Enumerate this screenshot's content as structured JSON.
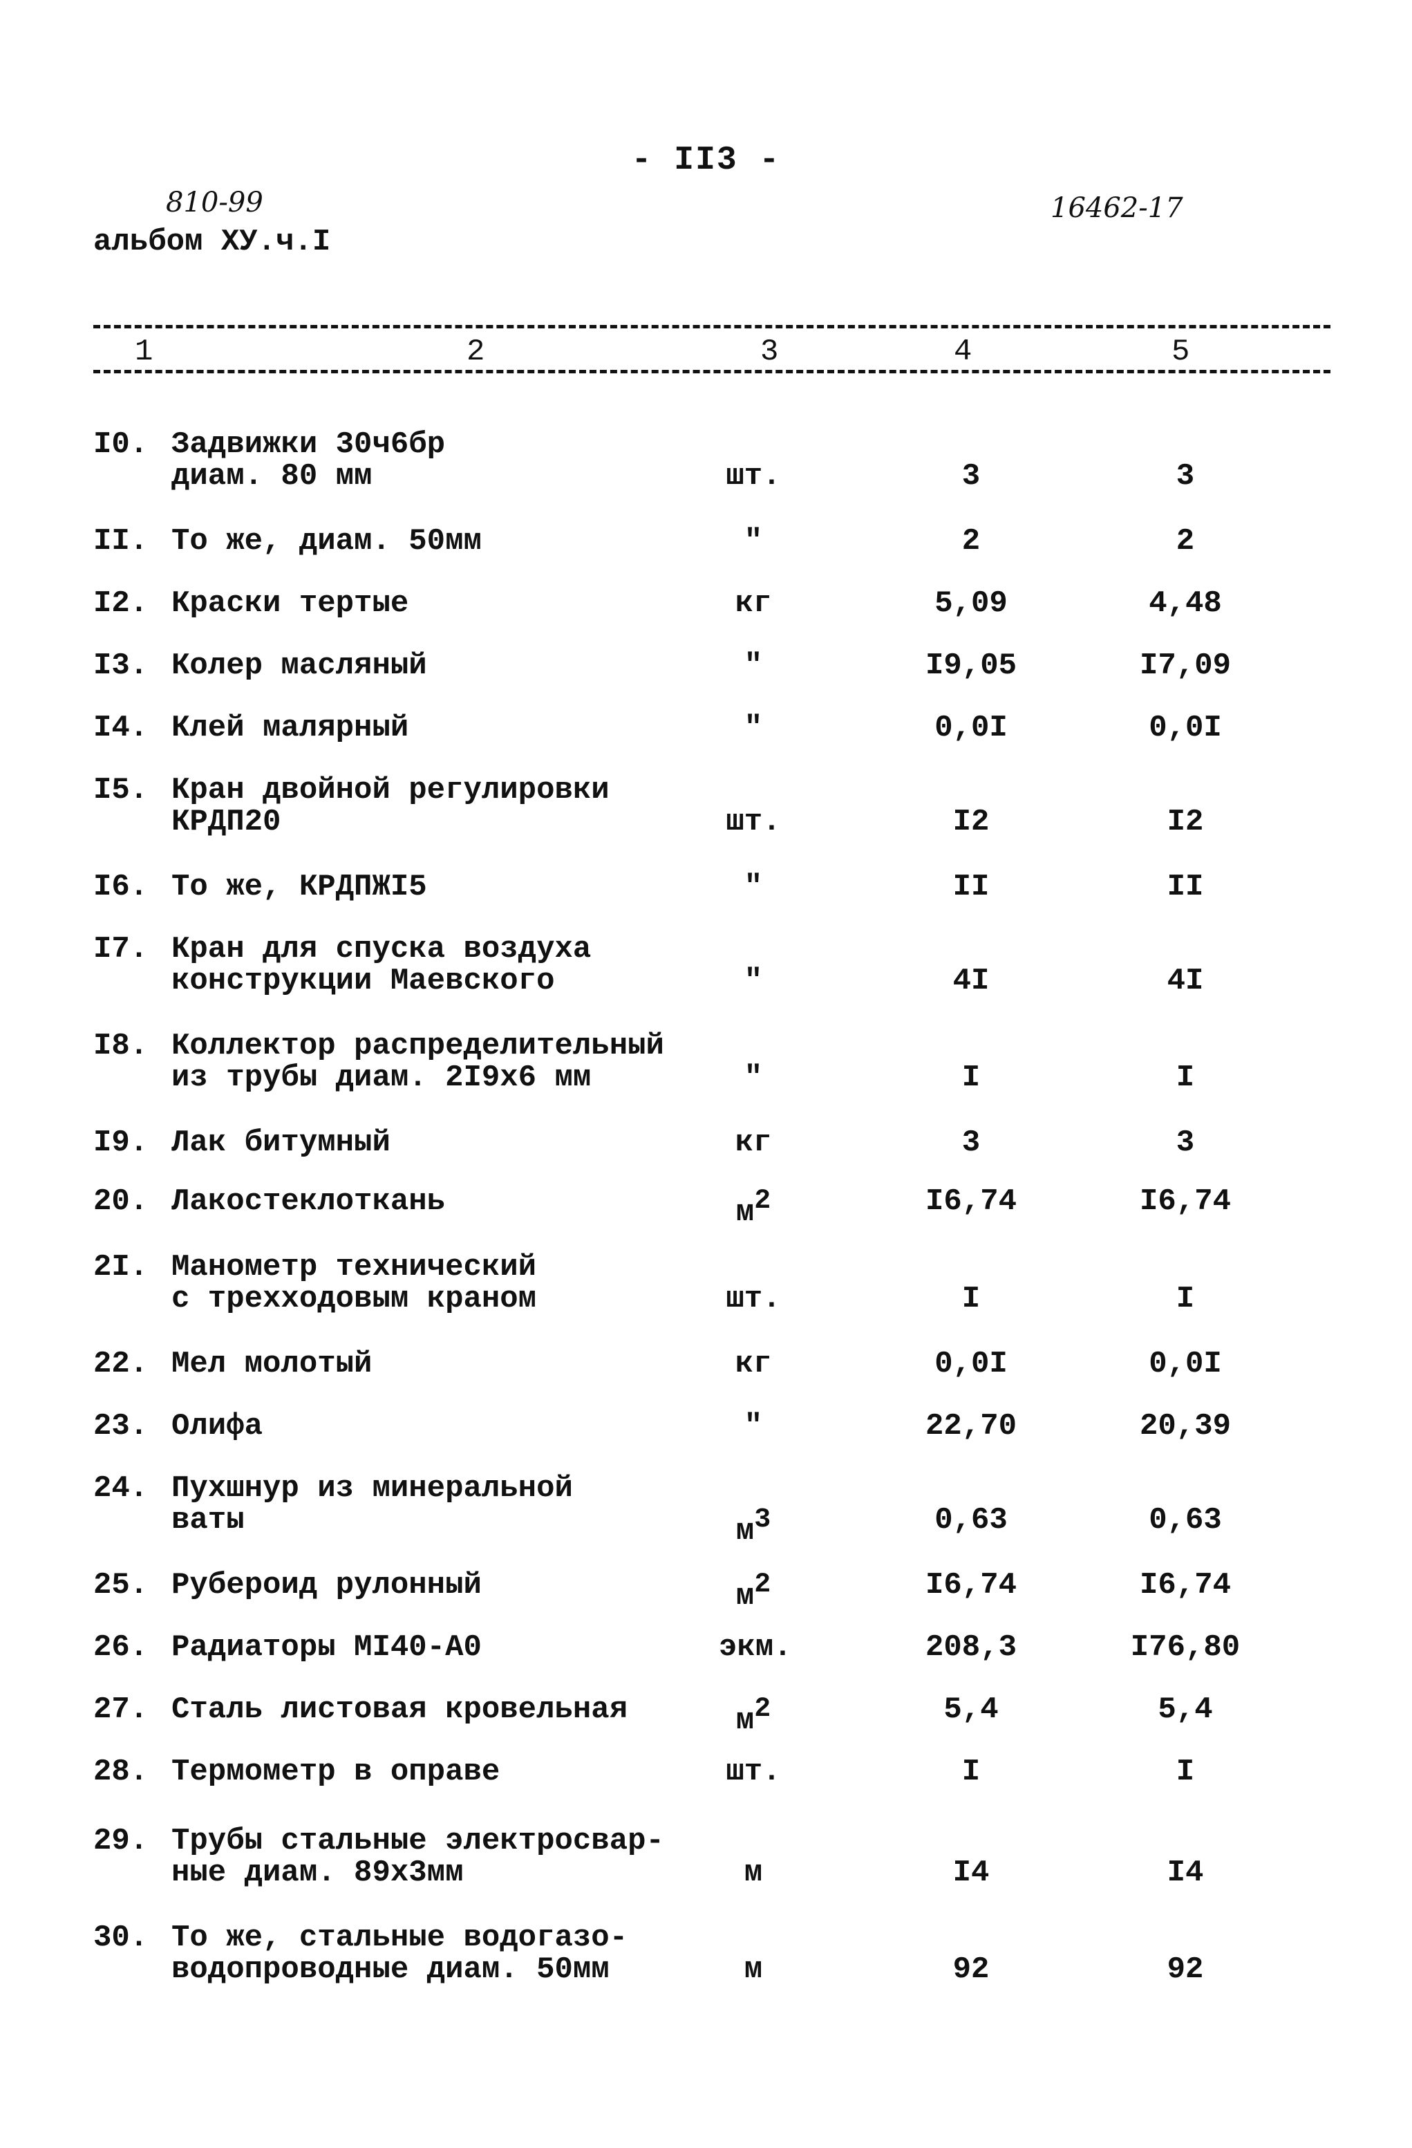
{
  "header": {
    "page_number": "- II3 -",
    "handwritten_left": "810-99",
    "handwritten_right": "16462-17",
    "album": "альбом ХУ.ч.I"
  },
  "columns": [
    "1",
    "2",
    "3",
    "4",
    "5"
  ],
  "rows": [
    {
      "num": "I0.",
      "name": "Задвижки 30ч6бр\nдиам. 80 мм",
      "unit": "шт.",
      "sup": "",
      "c4": "3",
      "c5": "3"
    },
    {
      "num": "II.",
      "name": "То же, диам. 50мм",
      "unit": "\"",
      "sup": "",
      "c4": "2",
      "c5": "2"
    },
    {
      "num": "I2.",
      "name": "Краски тертые",
      "unit": "кг",
      "sup": "",
      "c4": "5,09",
      "c5": "4,48"
    },
    {
      "num": "I3.",
      "name": "Колер масляный",
      "unit": "\"",
      "sup": "",
      "c4": "I9,05",
      "c5": "I7,09"
    },
    {
      "num": "I4.",
      "name": "Клей малярный",
      "unit": "\"",
      "sup": "",
      "c4": "0,0I",
      "c5": "0,0I"
    },
    {
      "num": "I5.",
      "name": "Кран двойной регулировки\nКРДП20",
      "unit": "шт.",
      "sup": "",
      "c4": "I2",
      "c5": "I2"
    },
    {
      "num": "I6.",
      "name": "То же, КРДПЖI5",
      "unit": "\"",
      "sup": "",
      "c4": "II",
      "c5": "II"
    },
    {
      "num": "I7.",
      "name": "Кран для спуска воздуха\nконструкции Маевского",
      "unit": "\"",
      "sup": "",
      "c4": "4I",
      "c5": "4I"
    },
    {
      "num": "I8.",
      "name": "Коллектор распределительный\nиз трубы диам. 2I9х6 мм",
      "unit": "\"",
      "sup": "",
      "c4": "I",
      "c5": "I"
    },
    {
      "num": "I9.",
      "name": "Лак битумный",
      "unit": "кг",
      "sup": "",
      "c4": "3",
      "c5": "3"
    },
    {
      "num": "20.",
      "name": "Лакостеклоткань",
      "unit": "м",
      "sup": "2",
      "c4": "I6,74",
      "c5": "I6,74"
    },
    {
      "num": "2I.",
      "name": "Манометр технический\nс трехходовым краном",
      "unit": "шт.",
      "sup": "",
      "c4": "I",
      "c5": "I"
    },
    {
      "num": "22.",
      "name": "Мел молотый",
      "unit": "кг",
      "sup": "",
      "c4": "0,0I",
      "c5": "0,0I"
    },
    {
      "num": "23.",
      "name": "Олифа",
      "unit": "\"",
      "sup": "",
      "c4": "22,70",
      "c5": "20,39"
    },
    {
      "num": "24.",
      "name": "Пухшнур из минеральной\nваты",
      "unit": "м",
      "sup": "3",
      "c4": "0,63",
      "c5": "0,63"
    },
    {
      "num": "25.",
      "name": "Рубероид рулонный",
      "unit": "м",
      "sup": "2",
      "c4": "I6,74",
      "c5": "I6,74"
    },
    {
      "num": "26.",
      "name": "Радиаторы МI40-А0",
      "unit": "экм.",
      "sup": "",
      "c4": "208,3",
      "c5": "I76,80"
    },
    {
      "num": "27.",
      "name": "Сталь листовая кровельная",
      "unit": "м",
      "sup": "2",
      "c4": "5,4",
      "c5": "5,4"
    },
    {
      "num": "28.",
      "name": "Термометр в оправе",
      "unit": "шт.",
      "sup": "",
      "c4": "I",
      "c5": "I"
    },
    {
      "num": "29.",
      "name": "Трубы стальные электросвар-\nные диам. 89х3мм",
      "unit": "м",
      "sup": "",
      "c4": "I4",
      "c5": "I4"
    },
    {
      "num": "30.",
      "name": "То же, стальные водогазо-\nводопроводные диам. 50мм",
      "unit": "м",
      "sup": "",
      "c4": "92",
      "c5": "92"
    }
  ]
}
